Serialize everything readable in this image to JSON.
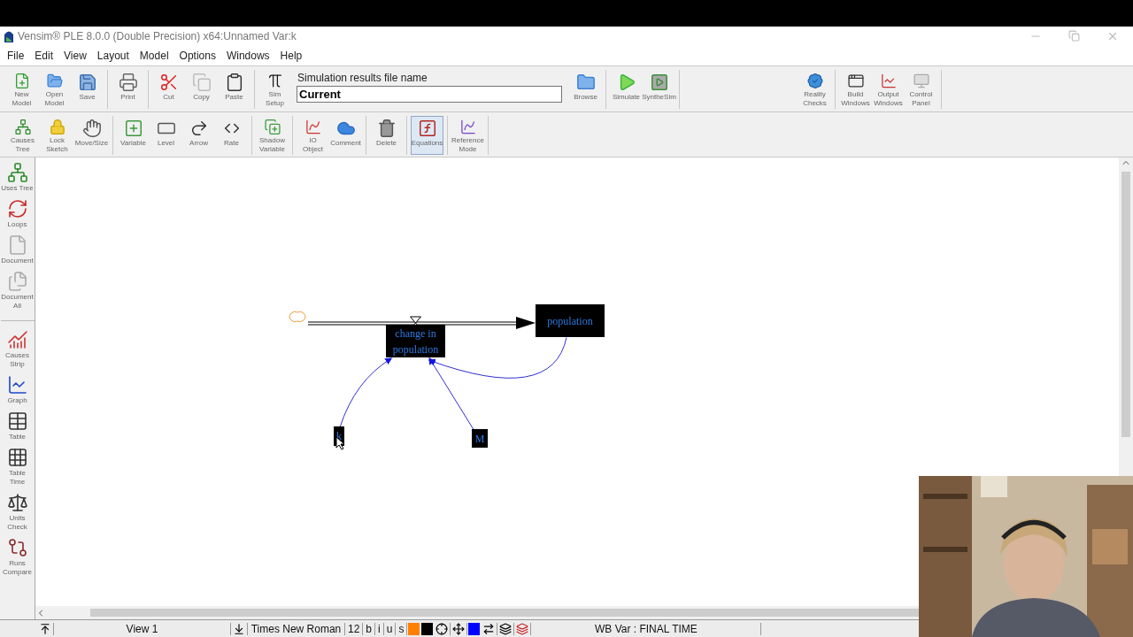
{
  "window": {
    "title": "Vensim® PLE 8.0.0 (Double Precision) x64:Unnamed Var:k"
  },
  "menu": [
    "File",
    "Edit",
    "View",
    "Layout",
    "Model",
    "Options",
    "Windows",
    "Help"
  ],
  "toolbar_top": [
    {
      "items": [
        {
          "kind": "button",
          "label": "New\nModel"
        },
        {
          "kind": "button",
          "label": "Open\nModel"
        },
        {
          "kind": "button",
          "label": "Save"
        }
      ]
    },
    {
      "items": [
        {
          "kind": "button",
          "label": "Print"
        }
      ]
    },
    {
      "items": [
        {
          "kind": "button",
          "label": "Cut"
        },
        {
          "kind": "button",
          "label": "Copy"
        },
        {
          "kind": "button",
          "label": "Paste"
        }
      ]
    },
    {
      "items": [
        {
          "kind": "button",
          "label": "Sim\nSetup"
        },
        {
          "kind": "field",
          "label": "Simulation results file name",
          "value": "Current"
        },
        {
          "kind": "button",
          "label": "Browse"
        }
      ]
    },
    {
      "items": [
        {
          "kind": "button",
          "label": "Simulate"
        },
        {
          "kind": "button",
          "label": "SyntheSim"
        }
      ]
    },
    {
      "items": [
        {
          "kind": "button",
          "label": "Reality\nChecks"
        }
      ]
    },
    {
      "items": [
        {
          "kind": "button",
          "label": "Build\nWindows"
        },
        {
          "kind": "button",
          "label": "Output\nWindows"
        },
        {
          "kind": "button",
          "label": "Control\nPanel"
        }
      ]
    }
  ],
  "toolbar_sketch": [
    {
      "items": [
        {
          "label": "Causes\nTree",
          "selected": false
        },
        {
          "label": "Lock\nSketch",
          "selected": false
        },
        {
          "label": "Move/Size",
          "selected": false
        }
      ]
    },
    {
      "items": [
        {
          "label": "Variable",
          "selected": false
        },
        {
          "label": "Level",
          "selected": false
        },
        {
          "label": "Arrow",
          "selected": false
        },
        {
          "label": "Rate",
          "selected": false
        }
      ]
    },
    {
      "items": [
        {
          "label": "Shadow\nVariable",
          "selected": false
        }
      ]
    },
    {
      "items": [
        {
          "label": "IO\nObject",
          "selected": false
        },
        {
          "label": "Comment",
          "selected": false
        }
      ]
    },
    {
      "items": [
        {
          "label": "Delete",
          "selected": false
        }
      ]
    },
    {
      "items": [
        {
          "label": "Equations",
          "selected": true
        }
      ]
    },
    {
      "items": [
        {
          "label": "Reference\nMode",
          "selected": false
        }
      ]
    }
  ],
  "analysis_sidebar": [
    {
      "items": [
        "Uses Tree",
        "Loops",
        "Document",
        "Document\nAll"
      ]
    },
    {
      "items": [
        "Causes\nStrip",
        "Graph",
        "Table",
        "Table\nTime",
        "Units\nCheck",
        "Runs\nCompare"
      ]
    }
  ],
  "diagram": {
    "nodes": [
      {
        "kind": "cloud"
      },
      {
        "kind": "rate",
        "label": "change in population"
      },
      {
        "kind": "stock",
        "label": "population"
      },
      {
        "kind": "auxiliary",
        "label": "k"
      },
      {
        "kind": "auxiliary",
        "label": "M"
      }
    ]
  },
  "status_bar": [
    {
      "kind": "icon"
    },
    {
      "kind": "text",
      "text": "View 1"
    },
    {
      "kind": "icon"
    },
    {
      "kind": "text",
      "text": "Times New Roman"
    },
    {
      "kind": "text",
      "text": "12"
    },
    {
      "kind": "text",
      "text": "b"
    },
    {
      "kind": "text",
      "text": "i"
    },
    {
      "kind": "text",
      "text": "u"
    },
    {
      "kind": "text",
      "text": "s"
    },
    {
      "kind": "swatch",
      "color": "#ff8000"
    },
    {
      "kind": "swatch",
      "color": "#000000"
    },
    {
      "kind": "icon"
    },
    {
      "kind": "icon"
    },
    {
      "kind": "swatch",
      "color": "#0000ff"
    },
    {
      "kind": "icon"
    },
    {
      "kind": "icon"
    },
    {
      "kind": "icon"
    },
    {
      "kind": "text",
      "text": "WB Var : FINAL TIME"
    }
  ]
}
